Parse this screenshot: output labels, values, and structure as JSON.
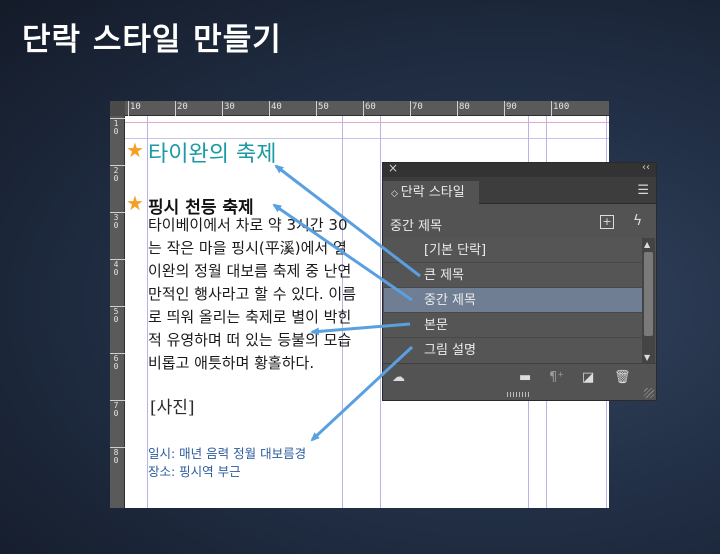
{
  "slide_title": "단락 스타일 만들기",
  "document": {
    "ruler_top": [
      "10",
      "20",
      "30",
      "40",
      "50",
      "60",
      "70",
      "80",
      "90",
      "100"
    ],
    "ruler_left": [
      "1\n0",
      "2\n0",
      "3\n0",
      "4\n0",
      "5\n0",
      "6\n0",
      "7\n0",
      "8\n0"
    ],
    "heading1": "타이완의 축제",
    "heading2": "핑시 천등 축제",
    "body_lines": [
      "타이베이에서 차로 약 3시간 30",
      "는 작은 마을 핑시(平溪)에서 열",
      "이완의 정월 대보름 축제 중 난연",
      "만적인 행사라고 할 수 있다. 이름",
      "로 띄워 올리는 축제로 별이 박힌",
      "적 유영하며 떠 있는 등불의 모습",
      "비롭고 애틋하며 황홀하다."
    ],
    "photo_placeholder": "[사진]",
    "caption_lines": [
      "일시: 매년 음력 정월 대보름경",
      "장소: 핑시역 부근"
    ]
  },
  "panel": {
    "tab_label": "단락 스타일",
    "current_style": "중간 제목",
    "styles": [
      "[기본 단락]",
      "큰 제목",
      "중간 제목",
      "본문",
      "그림 설명"
    ],
    "selected_index": 2
  },
  "colors": {
    "heading1": "#1a9aa3",
    "caption": "#2d5c9e",
    "arrow": "#5aa0e0",
    "star": "#f4a024",
    "selected_row": "#6f7e93"
  },
  "icons": {
    "close": "close-icon",
    "collapse": "collapse-icon",
    "panel_menu": "panel-menu-icon",
    "new_style_group": "add-style-icon",
    "quick_apply": "lightning-icon",
    "cloud_library": "cloud-library-icon",
    "new_folder": "folder-icon",
    "clear_overrides": "clear-overrides-icon",
    "new_style": "new-style-icon",
    "delete": "trash-icon"
  }
}
